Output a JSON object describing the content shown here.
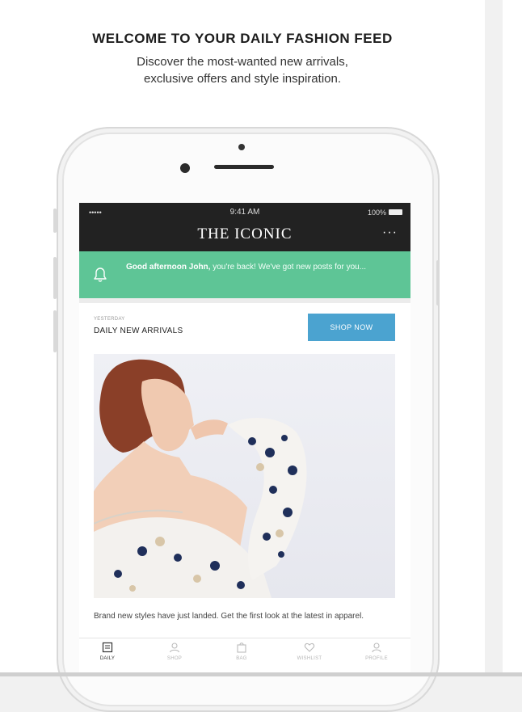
{
  "headline": "WELCOME TO YOUR DAILY FASHION FEED",
  "subline": [
    "Discover the most-wanted new arrivals,",
    "exclusive offers and style inspiration."
  ],
  "status_bar": {
    "signal": "•••••",
    "time": "9:41 AM",
    "battery": "100%"
  },
  "app": {
    "title": "THE ICONIC",
    "more": "···"
  },
  "greeting": {
    "bold": "Good afternoon John,",
    "text": " you're back! We've got new posts for you..."
  },
  "feed": {
    "small_label": "YESTERDAY",
    "label": "DAILY NEW ARRIVALS",
    "button": "SHOP NOW",
    "caption": "Brand new styles have just landed. Get the first look at the latest in apparel."
  },
  "tabs": [
    {
      "label": "DAILY",
      "icon": "daily-icon",
      "active": true
    },
    {
      "label": "SHOP",
      "icon": "shop-icon",
      "active": false
    },
    {
      "label": "BAG",
      "icon": "bag-icon",
      "active": false
    },
    {
      "label": "WISHLIST",
      "icon": "heart-icon",
      "active": false
    },
    {
      "label": "PROFILE",
      "icon": "profile-icon",
      "active": false
    }
  ],
  "colors": {
    "header": "#222222",
    "greeting": "#5ec596",
    "button": "#4ba3d0"
  }
}
